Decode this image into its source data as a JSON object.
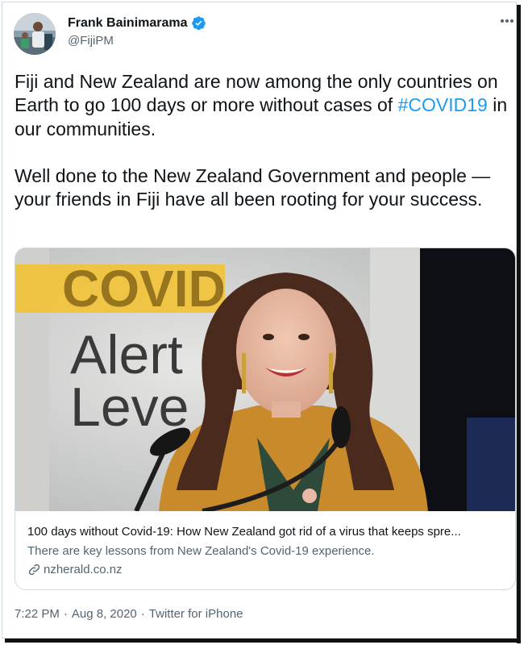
{
  "author": {
    "name": "Frank Bainimarama",
    "handle": "@FijiPM",
    "verified_icon": "verified-badge-icon",
    "avatar_icon": "avatar-photo"
  },
  "tweet": {
    "text_part1": "Fiji and New Zealand are now among the only countries on Earth to go 100 days or more without cases of ",
    "hashtag": "#COVID19",
    "text_part2": " in our communities.\n\nWell done to the New Zealand Government and people — your friends in Fiji have all been rooting for your success."
  },
  "card": {
    "image_text_line1": "COVID",
    "image_text_line2": "Alert",
    "image_text_line3": "Leve",
    "title": "100 days without Covid-19: How New Zealand got rid of a virus that keeps spre...",
    "description": "There are key lessons from New Zealand's Covid-19 experience.",
    "domain": "nzherald.co.nz",
    "link_icon": "link-icon"
  },
  "meta": {
    "time": "7:22 PM",
    "sep1": "·",
    "date": "Aug 8, 2020",
    "sep2": "·",
    "source": "Twitter for iPhone"
  },
  "colors": {
    "accent": "#1d9bf0",
    "text": "#0f1419",
    "muted": "#536471",
    "border": "#cfd9de"
  }
}
